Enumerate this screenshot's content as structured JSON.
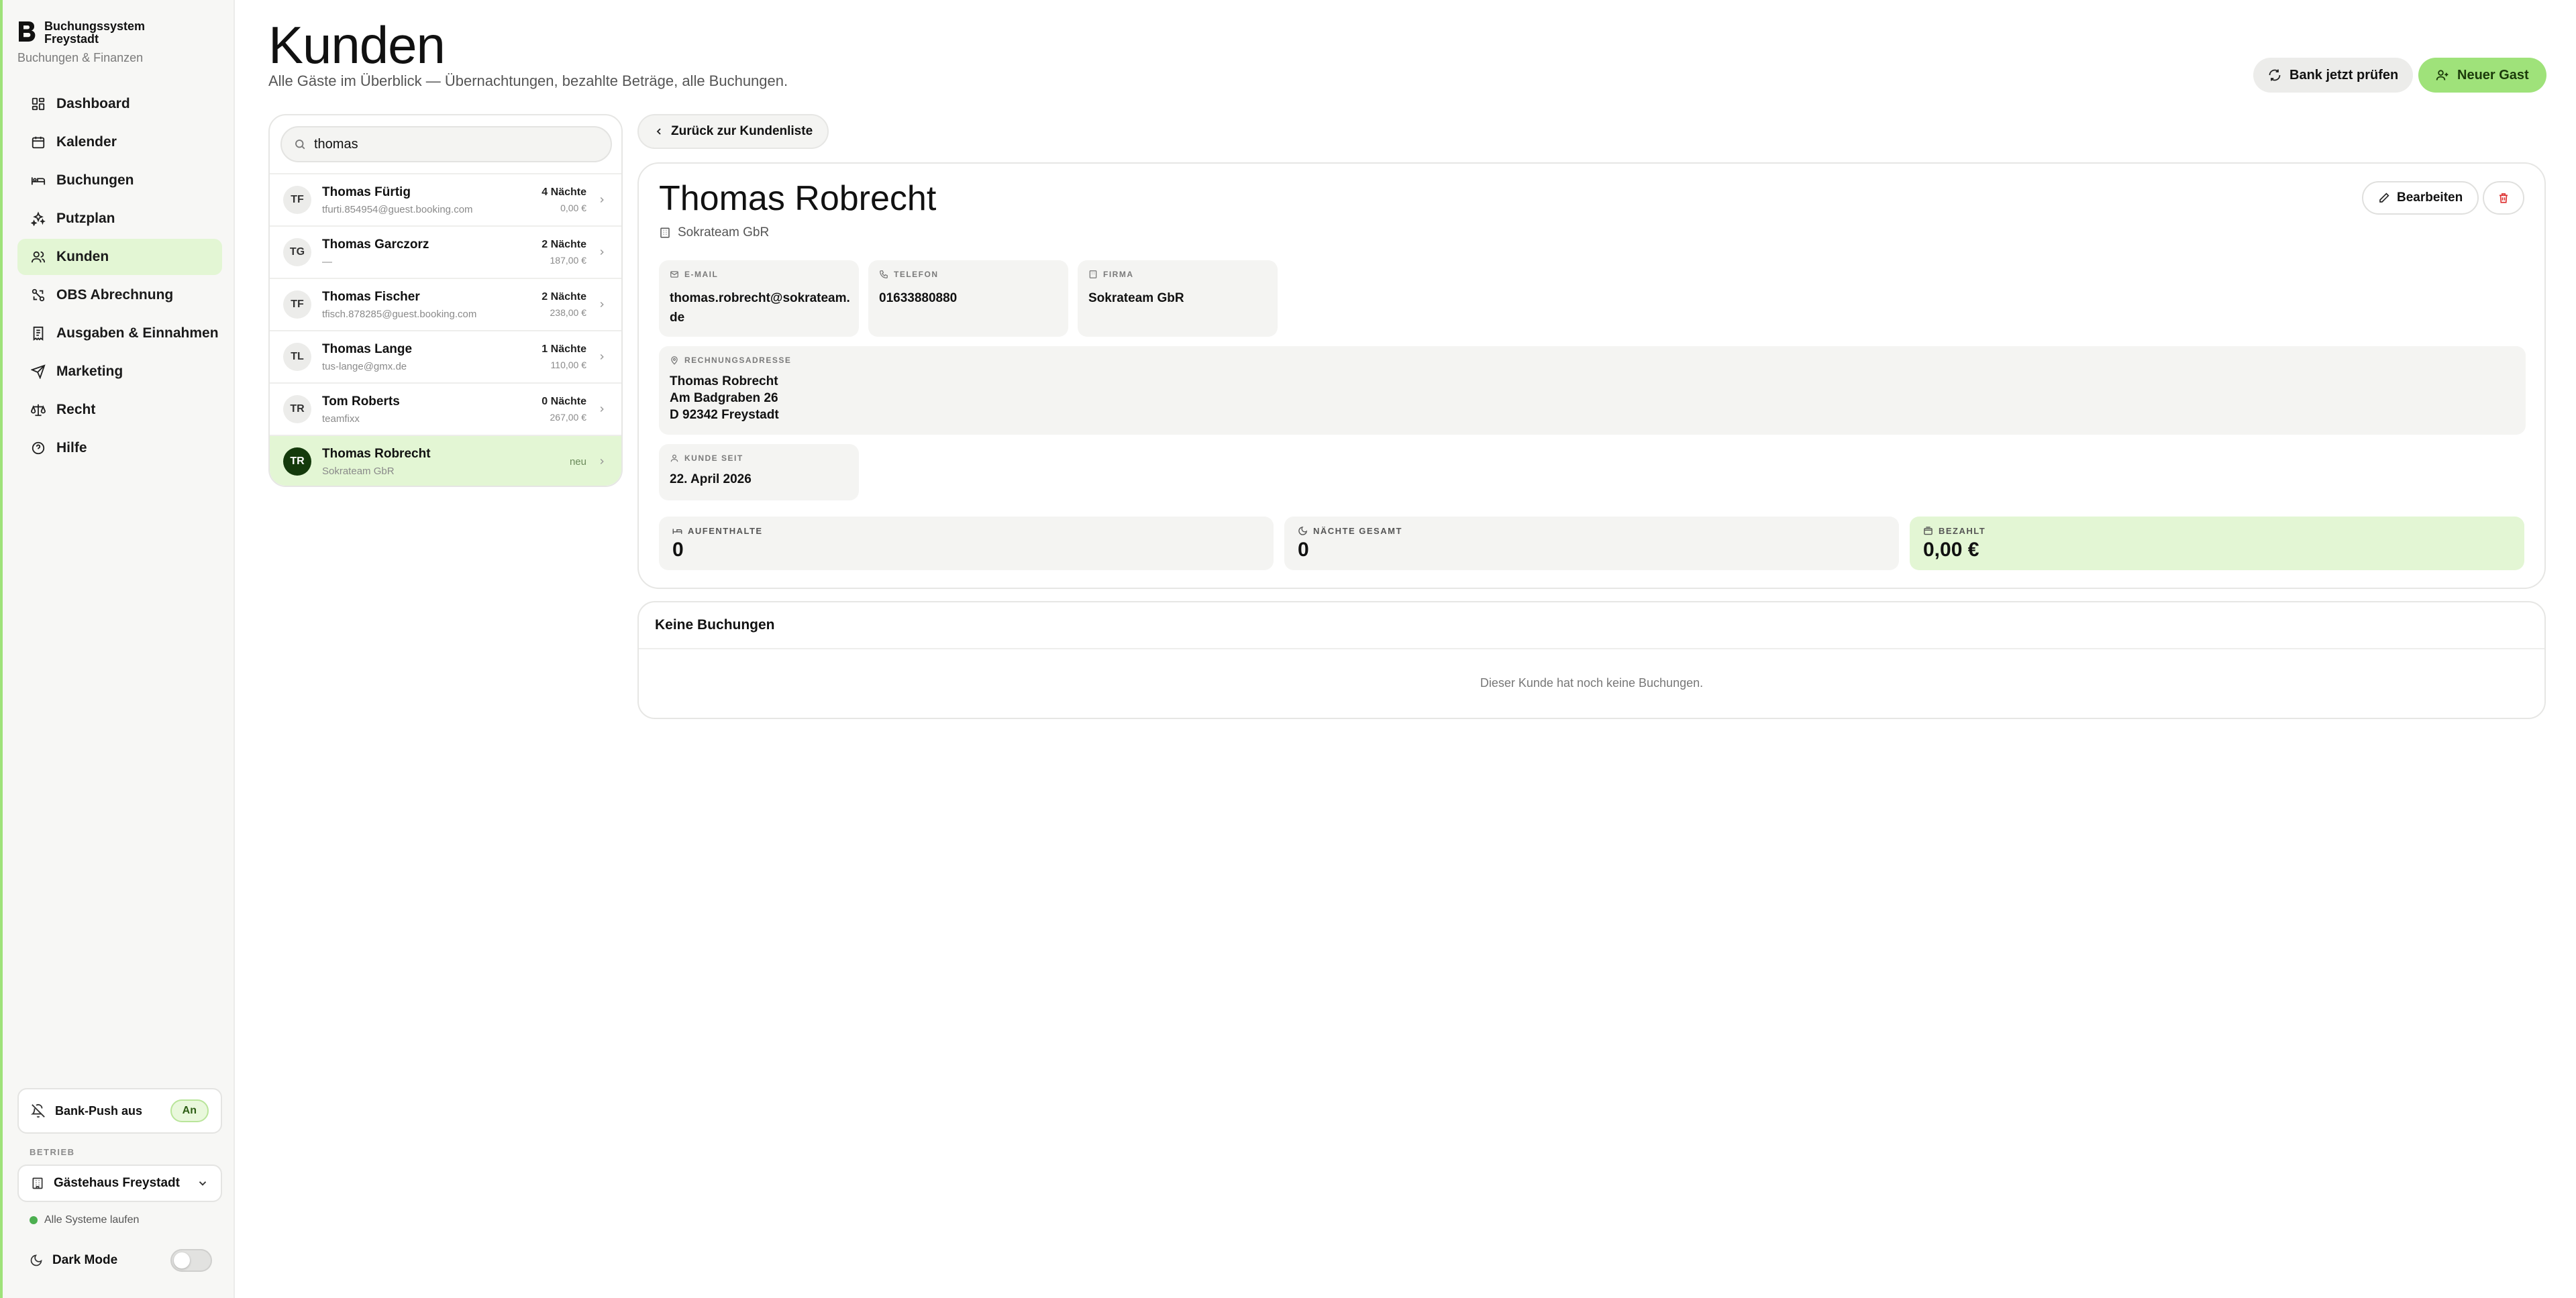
{
  "brand": {
    "name_line1": "Buchungssystem",
    "name_line2": "Freystadt",
    "subtitle": "Buchungen & Finanzen"
  },
  "nav": [
    {
      "label": "Dashboard",
      "icon": "dashboard-grid-icon"
    },
    {
      "label": "Kalender",
      "icon": "calendar-icon"
    },
    {
      "label": "Buchungen",
      "icon": "bed-icon"
    },
    {
      "label": "Putzplan",
      "icon": "sparkle-icon"
    },
    {
      "label": "Kunden",
      "icon": "users-icon",
      "active": true
    },
    {
      "label": "OBS Abrechnung",
      "icon": "scale-icon"
    },
    {
      "label": "Ausgaben & Einnahmen",
      "icon": "receipt-icon"
    },
    {
      "label": "Marketing",
      "icon": "send-icon"
    },
    {
      "label": "Recht",
      "icon": "law-scale-icon"
    },
    {
      "label": "Hilfe",
      "icon": "help-circle-icon"
    }
  ],
  "sidebar_bottom": {
    "bankpush_label": "Bank-Push aus",
    "bankpush_toggle": "An",
    "betrieb_label": "BETRIEB",
    "betrieb_value": "Gästehaus Freystadt",
    "status": "Alle Systeme laufen",
    "darkmode_label": "Dark Mode",
    "darkmode_on": false
  },
  "header": {
    "title": "Kunden",
    "subtitle": "Alle Gäste im Überblick — Übernachtungen, bezahlte Beträge, alle Buchungen.",
    "bank_button": "Bank jetzt prüfen",
    "new_button": "Neuer Gast"
  },
  "search": {
    "value": "thomas"
  },
  "customers": [
    {
      "initials": "TF",
      "name": "Thomas Fürtig",
      "sub": "tfurti.854954@guest.booking.com",
      "nights": "4 Nächte",
      "amount": "0,00 €"
    },
    {
      "initials": "TG",
      "name": "Thomas Garczorz",
      "sub": "—",
      "nights": "2 Nächte",
      "amount": "187,00 €"
    },
    {
      "initials": "TF",
      "name": "Thomas Fischer",
      "sub": "tfisch.878285@guest.booking.com",
      "nights": "2 Nächte",
      "amount": "238,00 €"
    },
    {
      "initials": "TL",
      "name": "Thomas Lange",
      "sub": "tus-lange@gmx.de",
      "nights": "1 Nächte",
      "amount": "110,00 €"
    },
    {
      "initials": "TR",
      "name": "Tom Roberts",
      "sub": "teamfixx",
      "nights": "0 Nächte",
      "amount": "267,00 €"
    },
    {
      "initials": "TR",
      "name": "Thomas Robrecht",
      "sub": "Sokrateam GbR",
      "badge": "neu",
      "selected": true
    }
  ],
  "detail": {
    "back_label": "Zurück zur Kundenliste",
    "name": "Thomas Robrecht",
    "company": "Sokrateam GbR",
    "edit_label": "Bearbeiten",
    "email_label": "E-MAIL",
    "email_line1": "thomas.robrecht@sokrateam.",
    "email_line2": "de",
    "phone_label": "TELEFON",
    "phone": "01633880880",
    "firma_label": "FIRMA",
    "firma": "Sokrateam GbR",
    "address_label": "RECHNUNGSADRESSE",
    "address_line1": "Thomas Robrecht",
    "address_line2": "Am Badgraben 26",
    "address_line3": "D 92342 Freystadt",
    "since_label": "KUNDE SEIT",
    "since": "22. April 2026",
    "stays_label": "AUFENTHALTE",
    "stays": "0",
    "nights_label": "NÄCHTE GESAMT",
    "nights": "0",
    "paid_label": "BEZAHLT",
    "paid": "0,00 €"
  },
  "bookings": {
    "title": "Keine Buchungen",
    "empty": "Dieser Kunde hat noch keine Buchungen."
  },
  "colors": {
    "accent": "#9fe27a",
    "accent_soft": "#e3f6d4",
    "selected_avatar": "#143a0c"
  }
}
